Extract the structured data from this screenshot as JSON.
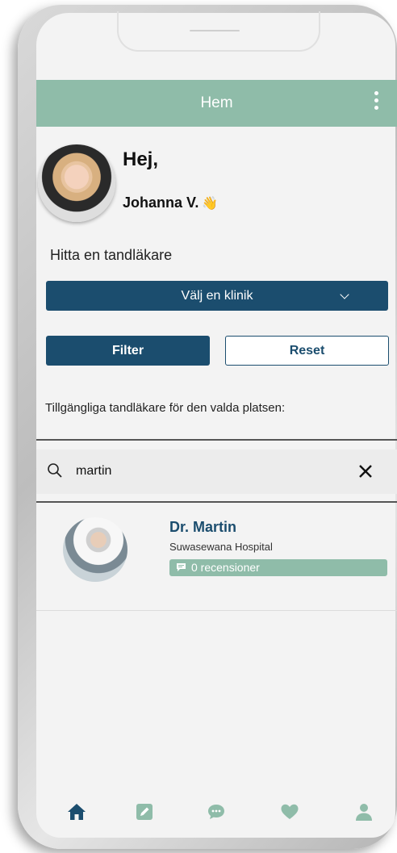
{
  "appbar": {
    "title": "Hem"
  },
  "greeting": {
    "hello": "Hej,",
    "name": "Johanna V.",
    "wave": "👋"
  },
  "search_section": {
    "title": "Hitta en tandläkare",
    "clinic_select": "Välj en klinik",
    "filter_label": "Filter",
    "reset_label": "Reset",
    "available_text": "Tillgängliga tandläkare för den valda platsen:"
  },
  "search": {
    "value": "martin"
  },
  "results": [
    {
      "name": "Dr. Martin",
      "hospital": "Suwasewana Hospital",
      "reviews": "0 recensioner"
    }
  ],
  "nav": [
    "home-icon",
    "edit-icon",
    "chat-icon",
    "heart-icon",
    "profile-icon"
  ],
  "colors": {
    "primary": "#1b4d6e",
    "accent": "#8fbca9",
    "active_nav": "#1b4d6e",
    "inactive_nav": "#8fbca9"
  }
}
